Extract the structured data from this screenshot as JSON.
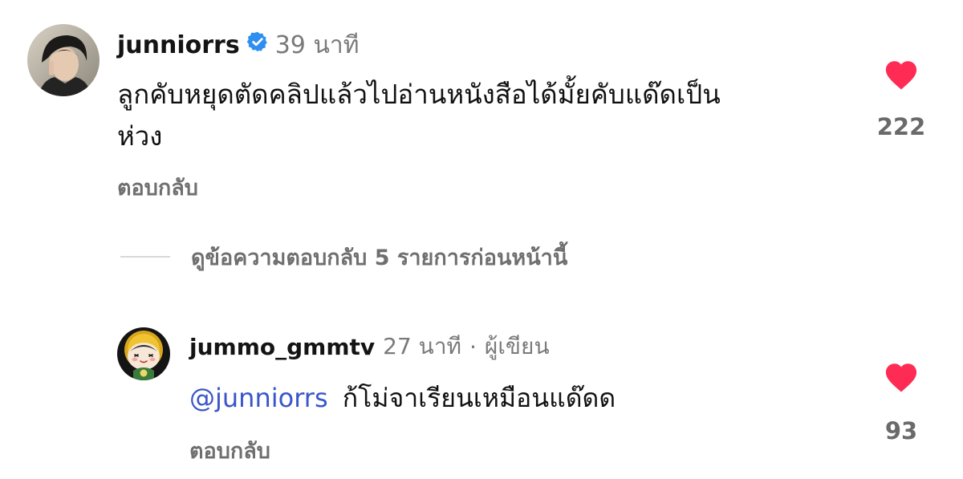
{
  "comments": [
    {
      "username": "junniorrs",
      "verified": true,
      "time": "39 นาที",
      "text_line1": "ลูกคับหยุดตัดคลิปแล้วไปอ่านหนังสือได้มั้ยคับแด๊ดเป็น",
      "text_line2": "ห่วง",
      "reply_label": "ตอบกลับ",
      "like_count": "222",
      "liked": true,
      "avatar_icon": "profile-photo"
    },
    {
      "username": "jummo_gmmtv",
      "time": "27 นาที",
      "separator": "·",
      "role": "ผู้เขียน",
      "mention": "@junniorrs",
      "text": "ก้โม่จาเรียนเหมือนแด๊ดด",
      "reply_label": "ตอบกลับ",
      "like_count": "93",
      "liked": true,
      "avatar_icon": "cartoon-character"
    }
  ],
  "view_replies": {
    "label": "ดูข้อความตอบกลับ 5 รายการก่อนหน้านี้"
  },
  "colors": {
    "heart": "#fe2c55",
    "verified_badge": "#2f8ff0",
    "mention": "#3a56c9",
    "muted": "#7a7a7a"
  }
}
